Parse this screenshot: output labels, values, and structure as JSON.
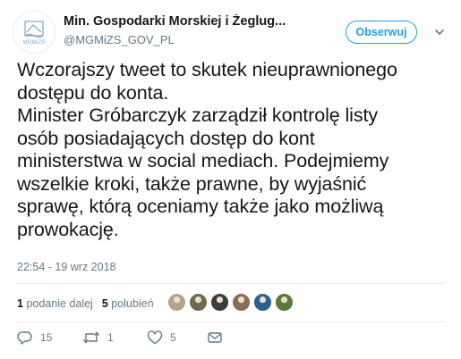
{
  "account": {
    "name": "Min. Gospodarki Morskiej i Żeglug...",
    "handle": "@MGMiZS_GOV_PL",
    "avatar_label": "MGMiZS",
    "avatar_icon": "ministry-logo-icon"
  },
  "follow_button": {
    "label": "Obserwuj",
    "color": "#1da1f2"
  },
  "tweet": {
    "lines": [
      "Wczorajszy tweet to skutek nieuprawnionego",
      "dostępu do konta.",
      "Minister Gróbarczyk zarządził kontrolę listy",
      "osób posiadających dostęp do kont",
      "ministerstwa w social mediach. Podejmiemy",
      "wszelkie kroki, także prawne, by wyjaśnić",
      "sprawę, którą oceniamy także jako możliwą",
      "prowokację."
    ],
    "timestamp": "22:54 - 19 wrz 2018"
  },
  "stats": {
    "retweets_count": "1",
    "retweets_label": "podanie dalej",
    "likes_count": "5",
    "likes_label": "polubień"
  },
  "likers": [
    {
      "icon": "user-avatar-1",
      "color": "#b7a38a"
    },
    {
      "icon": "user-avatar-2",
      "color": "#6f6a4f"
    },
    {
      "icon": "user-avatar-3",
      "color": "#3b3b3b"
    },
    {
      "icon": "user-avatar-4",
      "color": "#8a6d52"
    },
    {
      "icon": "user-avatar-5",
      "color": "#2a5f8f"
    },
    {
      "icon": "user-avatar-6",
      "color": "#5a7a3a"
    }
  ],
  "actions": {
    "reply_count": "15",
    "retweet_count": "1",
    "like_count": "5"
  }
}
